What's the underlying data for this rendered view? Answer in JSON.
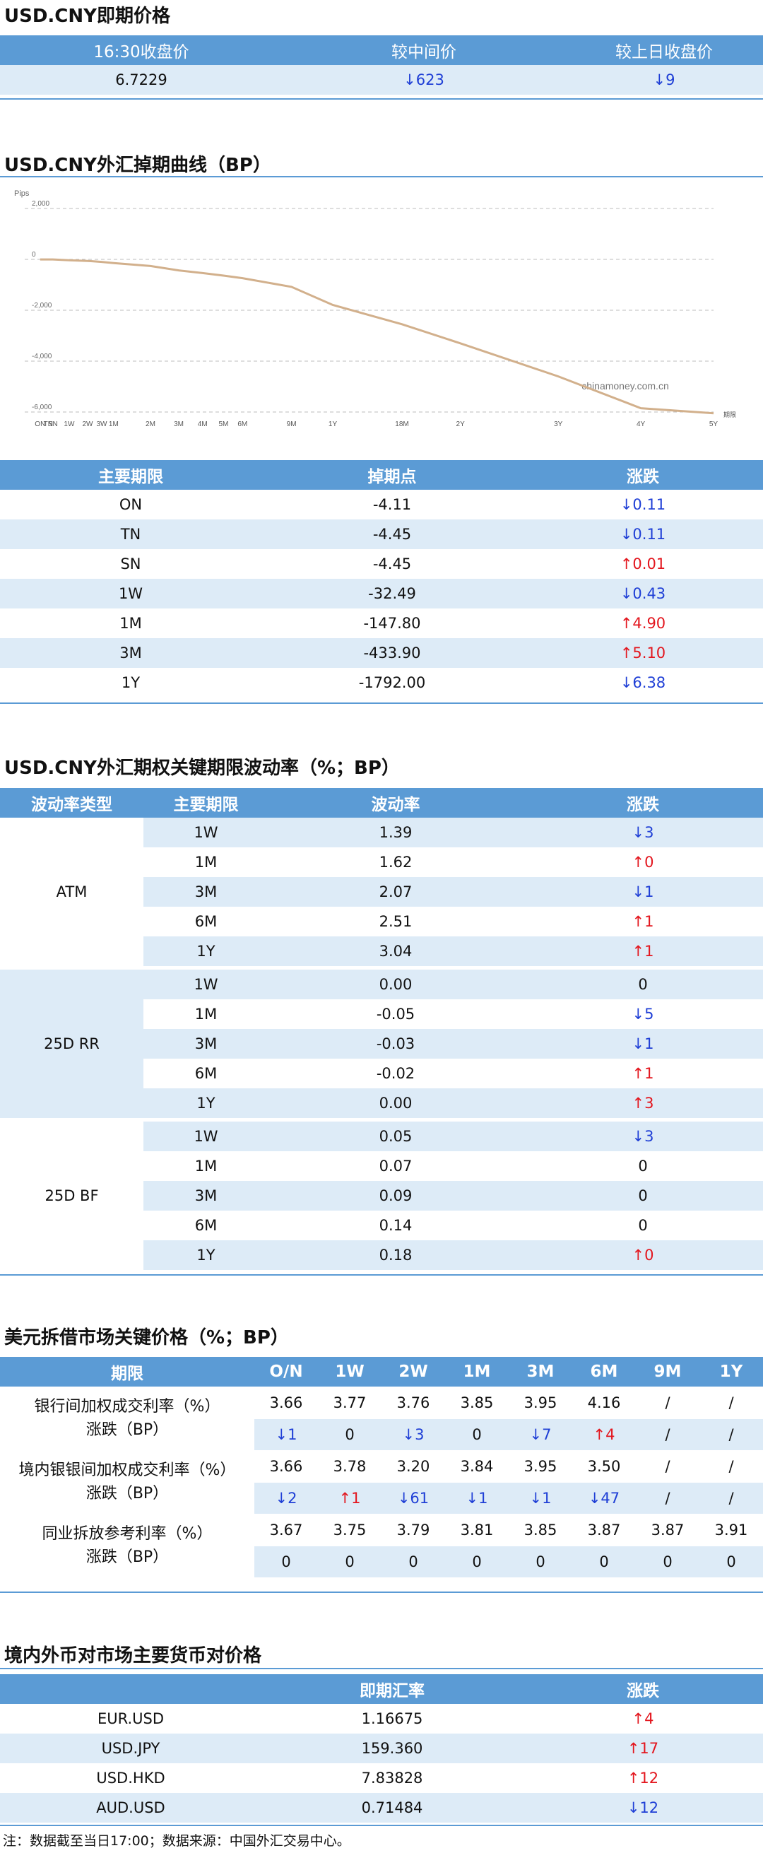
{
  "spot": {
    "title": "USD.CNY即期价格",
    "headers": [
      "16:30收盘价",
      "较中间价",
      "较上日收盘价"
    ],
    "row": {
      "close": "6.7229",
      "vs_mid": "↓623",
      "vs_mid_dir": "down",
      "vs_prev": "↓9",
      "vs_prev_dir": "down"
    }
  },
  "swap_curve": {
    "title": "USD.CNY外汇掉期曲线（BP）"
  },
  "chart_data": {
    "type": "line",
    "title": "",
    "ylabel": "Pips",
    "xlabel": "期限",
    "watermark": "chinamoney.com.cn",
    "ylim": [
      -6000,
      2000
    ],
    "yticks": [
      "2,000",
      "0",
      "-2,000",
      "-4,000",
      "-6,000"
    ],
    "ytick_values": [
      2000,
      0,
      -2000,
      -4000,
      -6000
    ],
    "categories": [
      "ON",
      "TN",
      "SN",
      "1W",
      "2W",
      "3W",
      "1M",
      "2M",
      "3M",
      "4M",
      "5M",
      "6M",
      "9M",
      "1Y",
      "18M",
      "2Y",
      "3Y",
      "4Y",
      "5Y"
    ],
    "x_months": [
      0.03,
      0.07,
      0.1,
      0.25,
      0.5,
      0.75,
      1,
      2,
      3,
      4,
      5,
      6,
      9,
      12,
      18,
      24,
      36,
      48,
      60
    ],
    "series": [
      {
        "color": "#d2b08c",
        "values": [
          -4,
          -4,
          -4,
          -32,
          -60,
          -100,
          -148,
          -260,
          -434,
          -540,
          -640,
          -740,
          -1080,
          -1792,
          -2550,
          -3300,
          -4600,
          -5850,
          -6050
        ]
      }
    ]
  },
  "swap_table": {
    "headers": [
      "主要期限",
      "掉期点",
      "涨跌"
    ],
    "rows": [
      {
        "term": "ON",
        "points": "-4.11",
        "chg": "↓0.11",
        "dir": "down"
      },
      {
        "term": "TN",
        "points": "-4.45",
        "chg": "↓0.11",
        "dir": "down"
      },
      {
        "term": "SN",
        "points": "-4.45",
        "chg": "↑0.01",
        "dir": "up"
      },
      {
        "term": "1W",
        "points": "-32.49",
        "chg": "↓0.43",
        "dir": "down"
      },
      {
        "term": "1M",
        "points": "-147.80",
        "chg": "↑4.90",
        "dir": "up"
      },
      {
        "term": "3M",
        "points": "-433.90",
        "chg": "↑5.10",
        "dir": "up"
      },
      {
        "term": "1Y",
        "points": "-1792.00",
        "chg": "↓6.38",
        "dir": "down"
      }
    ]
  },
  "vol": {
    "title": "USD.CNY外汇期权关键期限波动率（%；BP）",
    "headers": [
      "波动率类型",
      "主要期限",
      "波动率",
      "涨跌"
    ],
    "groups": [
      {
        "type": "ATM",
        "rows": [
          {
            "term": "1W",
            "vol": "1.39",
            "chg": "↓3",
            "dir": "down"
          },
          {
            "term": "1M",
            "vol": "1.62",
            "chg": "↑0",
            "dir": "up"
          },
          {
            "term": "3M",
            "vol": "2.07",
            "chg": "↓1",
            "dir": "down"
          },
          {
            "term": "6M",
            "vol": "2.51",
            "chg": "↑1",
            "dir": "up"
          },
          {
            "term": "1Y",
            "vol": "3.04",
            "chg": "↑1",
            "dir": "up"
          }
        ]
      },
      {
        "type": "25D RR",
        "rows": [
          {
            "term": "1W",
            "vol": "0.00",
            "chg": "0",
            "dir": "flat"
          },
          {
            "term": "1M",
            "vol": "-0.05",
            "chg": "↓5",
            "dir": "down"
          },
          {
            "term": "3M",
            "vol": "-0.03",
            "chg": "↓1",
            "dir": "down"
          },
          {
            "term": "6M",
            "vol": "-0.02",
            "chg": "↑1",
            "dir": "up"
          },
          {
            "term": "1Y",
            "vol": "0.00",
            "chg": "↑3",
            "dir": "up"
          }
        ]
      },
      {
        "type": "25D BF",
        "rows": [
          {
            "term": "1W",
            "vol": "0.05",
            "chg": "↓3",
            "dir": "down"
          },
          {
            "term": "1M",
            "vol": "0.07",
            "chg": "0",
            "dir": "flat"
          },
          {
            "term": "3M",
            "vol": "0.09",
            "chg": "0",
            "dir": "flat"
          },
          {
            "term": "6M",
            "vol": "0.14",
            "chg": "0",
            "dir": "flat"
          },
          {
            "term": "1Y",
            "vol": "0.18",
            "chg": "↑0",
            "dir": "up"
          }
        ]
      }
    ]
  },
  "lending": {
    "title": "美元拆借市场关键价格（%；BP）",
    "headers": [
      "期限",
      "O/N",
      "1W",
      "2W",
      "1M",
      "3M",
      "6M",
      "9M",
      "1Y"
    ],
    "groups": [
      {
        "label1": "银行间加权成交利率（%）",
        "label2": "涨跌（BP）",
        "rates": [
          "3.66",
          "3.77",
          "3.76",
          "3.85",
          "3.95",
          "4.16",
          "/",
          "/"
        ],
        "chgs": [
          {
            "v": "↓1",
            "d": "down"
          },
          {
            "v": "0",
            "d": "flat"
          },
          {
            "v": "↓3",
            "d": "down"
          },
          {
            "v": "0",
            "d": "flat"
          },
          {
            "v": "↓7",
            "d": "down"
          },
          {
            "v": "↑4",
            "d": "up"
          },
          {
            "v": "/",
            "d": "flat"
          },
          {
            "v": "/",
            "d": "flat"
          }
        ]
      },
      {
        "label1": "境内银银间加权成交利率（%）",
        "label2": "涨跌（BP）",
        "rates": [
          "3.66",
          "3.78",
          "3.20",
          "3.84",
          "3.95",
          "3.50",
          "/",
          "/"
        ],
        "chgs": [
          {
            "v": "↓2",
            "d": "down"
          },
          {
            "v": "↑1",
            "d": "up"
          },
          {
            "v": "↓61",
            "d": "down"
          },
          {
            "v": "↓1",
            "d": "down"
          },
          {
            "v": "↓1",
            "d": "down"
          },
          {
            "v": "↓47",
            "d": "down"
          },
          {
            "v": "/",
            "d": "flat"
          },
          {
            "v": "/",
            "d": "flat"
          }
        ]
      },
      {
        "label1": "同业拆放参考利率（%）",
        "label2": "涨跌（BP）",
        "rates": [
          "3.67",
          "3.75",
          "3.79",
          "3.81",
          "3.85",
          "3.87",
          "3.87",
          "3.91"
        ],
        "chgs": [
          {
            "v": "0",
            "d": "flat"
          },
          {
            "v": "0",
            "d": "flat"
          },
          {
            "v": "0",
            "d": "flat"
          },
          {
            "v": "0",
            "d": "flat"
          },
          {
            "v": "0",
            "d": "flat"
          },
          {
            "v": "0",
            "d": "flat"
          },
          {
            "v": "0",
            "d": "flat"
          },
          {
            "v": "0",
            "d": "flat"
          }
        ]
      }
    ]
  },
  "fx": {
    "title": "境内外币对市场主要货币对价格",
    "headers": [
      "",
      "即期汇率",
      "涨跌"
    ],
    "rows": [
      {
        "pair": "EUR.USD",
        "rate": "1.16675",
        "chg": "↑4",
        "dir": "up"
      },
      {
        "pair": "USD.JPY",
        "rate": "159.360",
        "chg": "↑17",
        "dir": "up"
      },
      {
        "pair": "USD.HKD",
        "rate": "7.83828",
        "chg": "↑12",
        "dir": "up"
      },
      {
        "pair": "AUD.USD",
        "rate": "0.71484",
        "chg": "↓12",
        "dir": "down"
      }
    ]
  },
  "note": "注：数据截至当日17:00；数据来源：中国外汇交易中心。"
}
